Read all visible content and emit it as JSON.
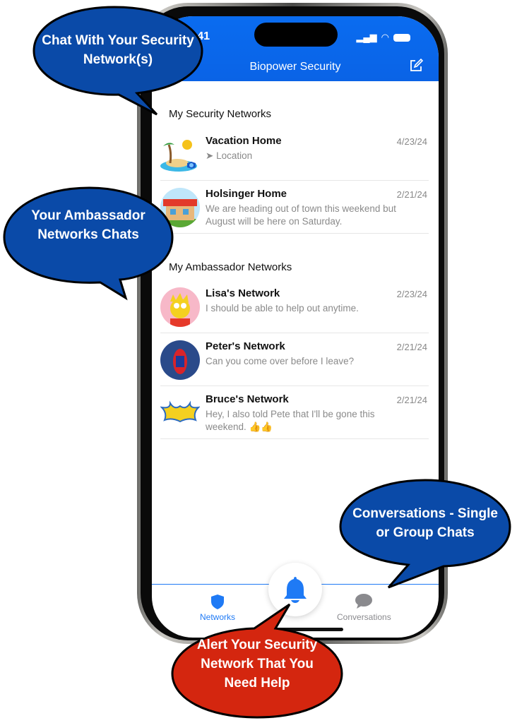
{
  "status": {
    "time": "9:41"
  },
  "header": {
    "title": "Biopower Security",
    "compose_icon": "compose-icon"
  },
  "sections": [
    {
      "title": "My Security Networks",
      "items": [
        {
          "name": "Vacation Home",
          "date": "4/23/24",
          "message": "Location",
          "message_icon": "location-arrow-icon"
        },
        {
          "name": "Holsinger Home",
          "date": "2/21/24",
          "message": "We are heading out of town this weekend but August will be here on Saturday."
        }
      ]
    },
    {
      "title": "My Ambassador Networks",
      "items": [
        {
          "name": "Lisa's Network",
          "date": "2/23/24",
          "message": "I should be able to help out anytime."
        },
        {
          "name": "Peter's Network",
          "date": "2/21/24",
          "message": "Can you come over before I leave?"
        },
        {
          "name": "Bruce's Network",
          "date": "2/21/24",
          "message": "Hey, I also told Pete that I'll be gone this weekend. 👍👍"
        }
      ]
    }
  ],
  "tabbar": {
    "networks": "Networks",
    "conversations": "Conversations",
    "alert_icon": "bell-icon"
  },
  "colors": {
    "accent": "#0a6cf0",
    "callout_blue": "#0a4aa8",
    "callout_red": "#d4260f"
  },
  "callouts": {
    "security": "Chat With Your Security Network(s)",
    "ambassador": "Your Ambassador Networks Chats",
    "conversations": "Conversations - Single or Group Chats",
    "alert": "Alert Your Security Network That You Need Help"
  }
}
